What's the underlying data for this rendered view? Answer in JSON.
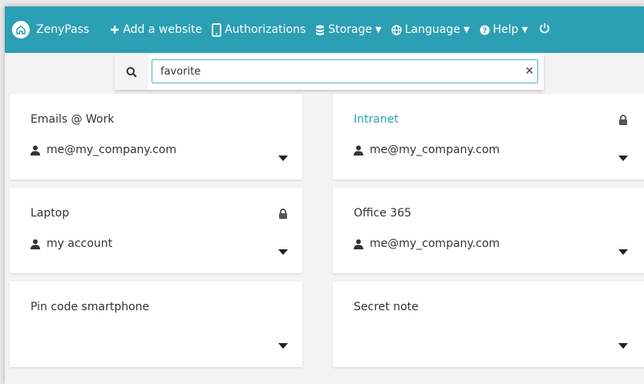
{
  "app": {
    "name": "ZenyPass",
    "accent": "#2b9fb3"
  },
  "nav": {
    "add_website": "Add a website",
    "authorizations": "Authorizations",
    "storage": "Storage",
    "language": "Language",
    "help": "Help"
  },
  "search": {
    "value": "favorite"
  },
  "cards": [
    {
      "title": "Emails @ Work",
      "account": "me@my_company.com",
      "locked": false,
      "highlight": false
    },
    {
      "title": "Intranet",
      "account": "me@my_company.com",
      "locked": true,
      "highlight": true
    },
    {
      "title": "Laptop",
      "account": "my account",
      "locked": true,
      "highlight": false
    },
    {
      "title": "Office 365",
      "account": "me@my_company.com",
      "locked": false,
      "highlight": false
    },
    {
      "title": "Pin code smartphone",
      "account": "",
      "locked": false,
      "highlight": false
    },
    {
      "title": "Secret note",
      "account": "",
      "locked": false,
      "highlight": false
    }
  ]
}
